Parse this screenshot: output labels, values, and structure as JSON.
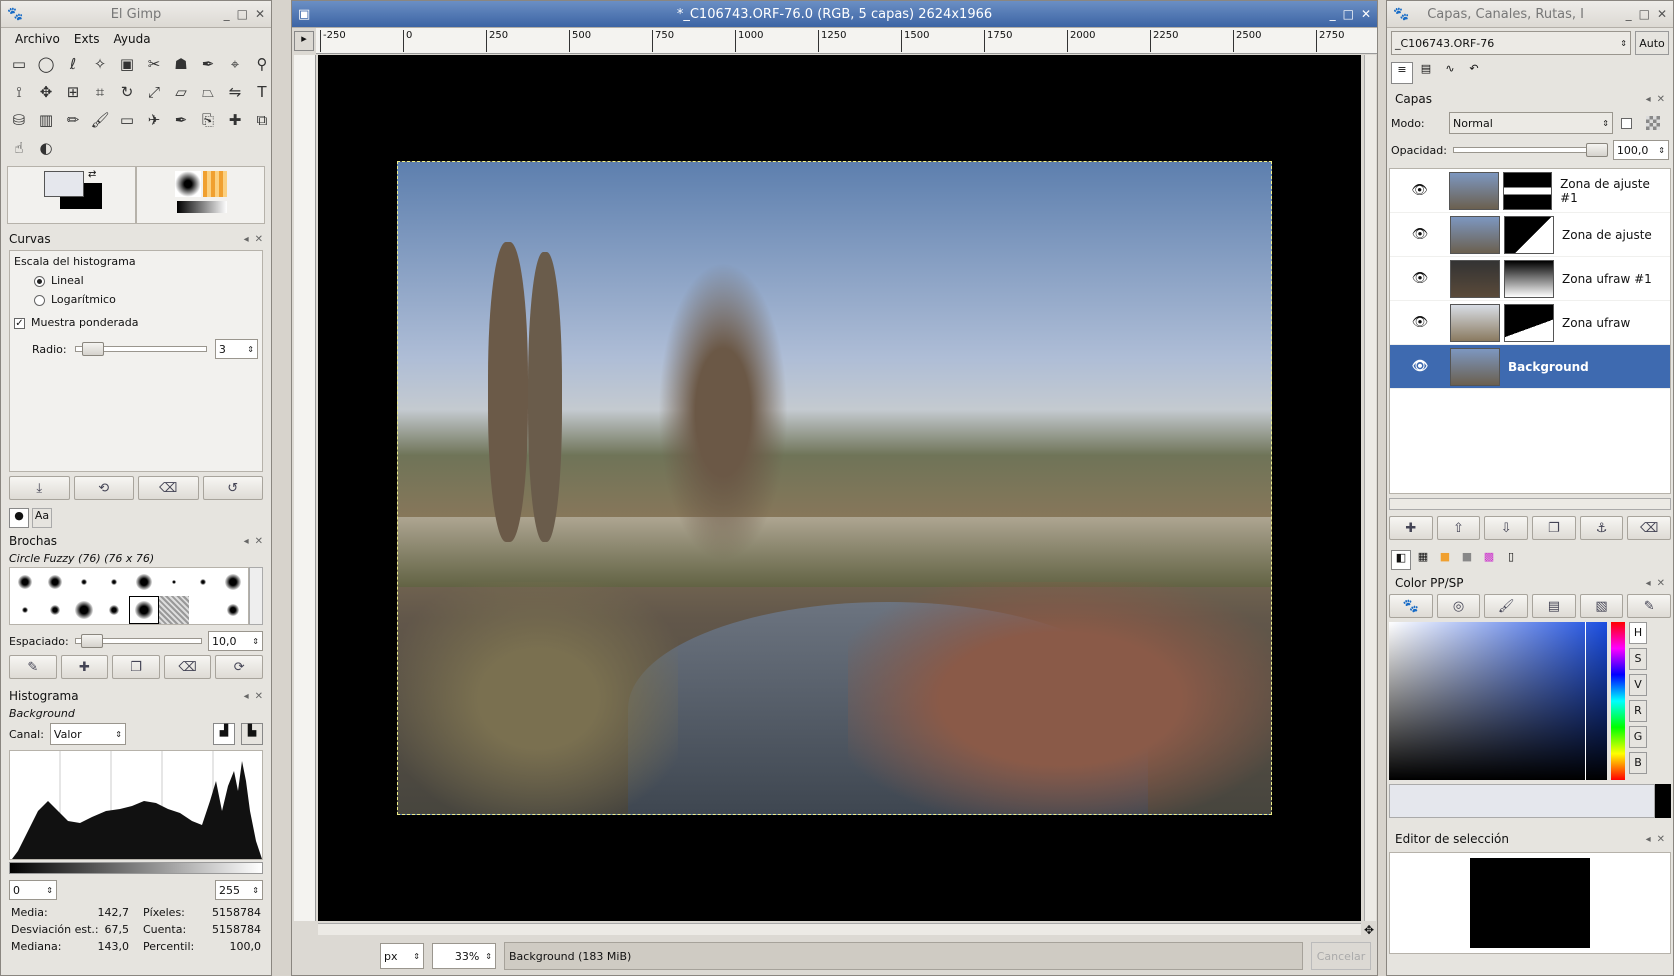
{
  "toolbox": {
    "title": "El Gimp",
    "menu": [
      "Archivo",
      "Exts",
      "Ayuda"
    ],
    "tools": [
      "rect-select",
      "ellipse-select",
      "free-select",
      "fuzzy-select",
      "color-select",
      "scissors",
      "foreground-select",
      "paths",
      "color-picker",
      "zoom",
      "measure",
      "move",
      "align",
      "crop",
      "rotate",
      "scale",
      "shear",
      "perspective",
      "flip",
      "text",
      "bucket-fill",
      "blend",
      "pencil",
      "paintbrush",
      "eraser",
      "airbrush",
      "ink",
      "clone",
      "heal",
      "perspective-clone",
      "smudge",
      "dodge"
    ]
  },
  "curves": {
    "title": "Curvas",
    "histogram_scale_label": "Escala del histograma",
    "linear": "Lineal",
    "log": "Logarítmico",
    "sample_merged": "Muestra ponderada",
    "radius_label": "Radio:",
    "radius_value": "3",
    "radius_fraction": 0.05
  },
  "brushes": {
    "title": "Brochas",
    "tab_text": "Aa",
    "selected": "Circle Fuzzy (76) (76 x 76)",
    "spacing_label": "Espaciado:",
    "spacing_value": "10,0",
    "spacing_fraction": 0.05
  },
  "histogram": {
    "title": "Histograma",
    "layer": "Background",
    "channel_label": "Canal:",
    "channel_value": "Valor",
    "range_min": "0",
    "range_max": "255",
    "media_label": "Media:",
    "media": "142,7",
    "desv_label": "Desviación est.:",
    "desv": "67,5",
    "mediana_label": "Mediana:",
    "mediana": "143,0",
    "pixeles_label": "Píxeles:",
    "pixeles": "5158784",
    "cuenta_label": "Cuenta:",
    "cuenta": "5158784",
    "percentil_label": "Percentil:",
    "percentil": "100,0"
  },
  "image_window": {
    "title": "*_C106743.ORF-76.0 (RGB, 5 capas) 2624x1966",
    "ruler_ticks": [
      "-250",
      "0",
      "250",
      "500",
      "750",
      "1000",
      "1250",
      "1500",
      "1750",
      "2000",
      "2250",
      "2500",
      "2750"
    ],
    "unit": "px",
    "zoom": "33%",
    "status": "Background (183 MiB)",
    "cancel": "Cancelar"
  },
  "layers_dock": {
    "title": "Capas, Canales, Rutas, I",
    "image_select": "_C106743.ORF-76",
    "auto": "Auto",
    "section": "Capas",
    "mode_label": "Modo:",
    "mode_value": "Normal",
    "opacity_label": "Opacidad:",
    "opacity_value": "100,0",
    "opacity_fraction": 1.0,
    "layers": [
      {
        "name": "Zona de ajuste #1",
        "selected": false
      },
      {
        "name": "Zona de ajuste",
        "selected": false
      },
      {
        "name": "Zona ufraw #1",
        "selected": false
      },
      {
        "name": "Zona ufraw",
        "selected": false
      },
      {
        "name": "Background",
        "selected": true
      }
    ]
  },
  "color_dock": {
    "title": "Color PP/SP",
    "channels": [
      "H",
      "S",
      "V",
      "R",
      "G",
      "B"
    ]
  },
  "selection_editor": {
    "title": "Editor de selección"
  }
}
